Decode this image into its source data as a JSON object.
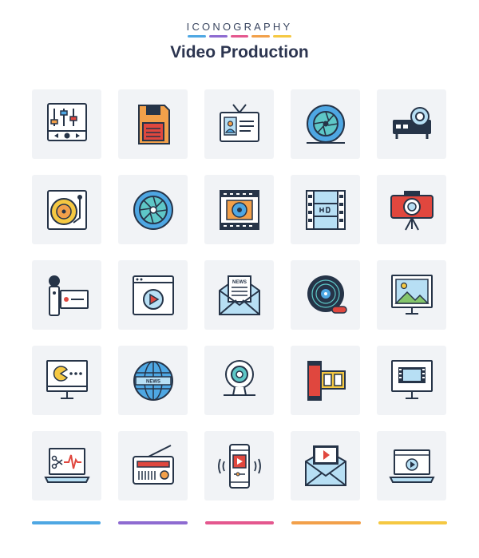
{
  "header": {
    "brand": "ICONOGRAPHY",
    "title": "Video Production"
  },
  "colors": {
    "outline": "#263448",
    "blue": "#4ea7e3",
    "lightblue": "#b7dff4",
    "teal": "#5ec7c7",
    "red": "#e0473e",
    "orange": "#f2a04a",
    "yellow": "#f5c842",
    "green": "#84c56b",
    "purple": "#8e6bd1",
    "pink": "#e4578e",
    "tile": "#f1f3f6"
  },
  "brand_bars": [
    "#4ea7e3",
    "#8e6bd1",
    "#e4578e",
    "#f2a04a",
    "#f5c842"
  ],
  "bottom_bars": [
    "#4ea7e3",
    "#8e6bd1",
    "#e4578e",
    "#f2a04a",
    "#f5c842"
  ],
  "icons": [
    "equalizer-panel-icon",
    "floppy-disk-icon",
    "id-card-icon",
    "camera-aperture-icon",
    "projector-icon",
    "vinyl-turntable-icon",
    "shutter-icon",
    "film-frame-icon",
    "hd-film-strip-icon",
    "camera-tripod-icon",
    "handheld-camera-icon",
    "video-player-window-icon",
    "news-mail-icon",
    "vinyl-record-icon",
    "landscape-monitor-icon",
    "pacman-monitor-icon",
    "news-globe-icon",
    "webcam-icon",
    "film-roll-icon",
    "film-monitor-icon",
    "audio-edit-laptop-icon",
    "radio-icon",
    "mobile-video-icon",
    "video-mail-icon",
    "video-laptop-icon"
  ]
}
